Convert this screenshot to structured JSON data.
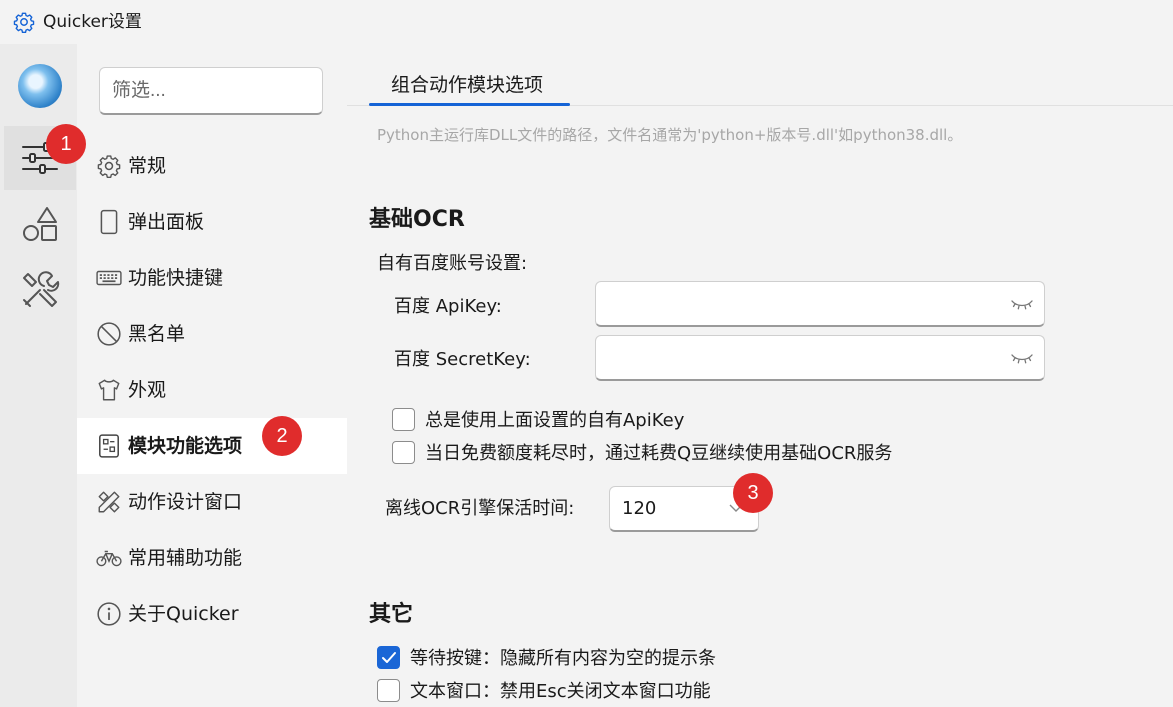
{
  "window": {
    "title": "Quicker设置"
  },
  "rail": {
    "items": [
      {
        "name": "settings-sliders",
        "active": true
      },
      {
        "name": "shapes",
        "active": false
      },
      {
        "name": "tools",
        "active": false
      }
    ]
  },
  "nav": {
    "filter_placeholder": "筛选...",
    "items": [
      {
        "label": "常规",
        "icon": "gear-icon"
      },
      {
        "label": "弹出面板",
        "icon": "panel-icon"
      },
      {
        "label": "功能快捷键",
        "icon": "keyboard-icon"
      },
      {
        "label": "黑名单",
        "icon": "prohibited-icon"
      },
      {
        "label": "外观",
        "icon": "tshirt-icon"
      },
      {
        "label": "模块功能选项",
        "icon": "module-icon",
        "active": true
      },
      {
        "label": "动作设计窗口",
        "icon": "design-tools-icon"
      },
      {
        "label": "常用辅助功能",
        "icon": "bicycle-icon"
      },
      {
        "label": "关于Quicker",
        "icon": "info-icon"
      }
    ]
  },
  "main": {
    "tab_label": "组合动作模块选项",
    "hint": "Python主运行库DLL文件的路径，文件名通常为'python+版本号.dll'如python38.dll。",
    "ocr": {
      "section_title": "基础OCR",
      "account_title": "自有百度账号设置:",
      "apikey_label": "百度 ApiKey:",
      "secret_label": "百度 SecretKey:",
      "apikey_value": "",
      "secret_value": "",
      "always_use_label": "总是使用上面设置的自有ApiKey",
      "always_use_checked": false,
      "use_qbean_label": "当日免费额度耗尽时，通过耗费Q豆继续使用基础OCR服务",
      "use_qbean_checked": false,
      "keepalive_label": "离线OCR引擎保活时间:",
      "keepalive_value": "120"
    },
    "other": {
      "section_title": "其它",
      "wait_key_label": "等待按键：隐藏所有内容为空的提示条",
      "wait_key_checked": true,
      "text_window_label": "文本窗口：禁用Esc关闭文本窗口功能",
      "text_window_checked": false
    }
  },
  "badges": [
    "1",
    "2",
    "3"
  ],
  "colors": {
    "accent": "#1463d6",
    "badge": "#e02c2c",
    "checkbox_checked": "#1a66d6"
  }
}
